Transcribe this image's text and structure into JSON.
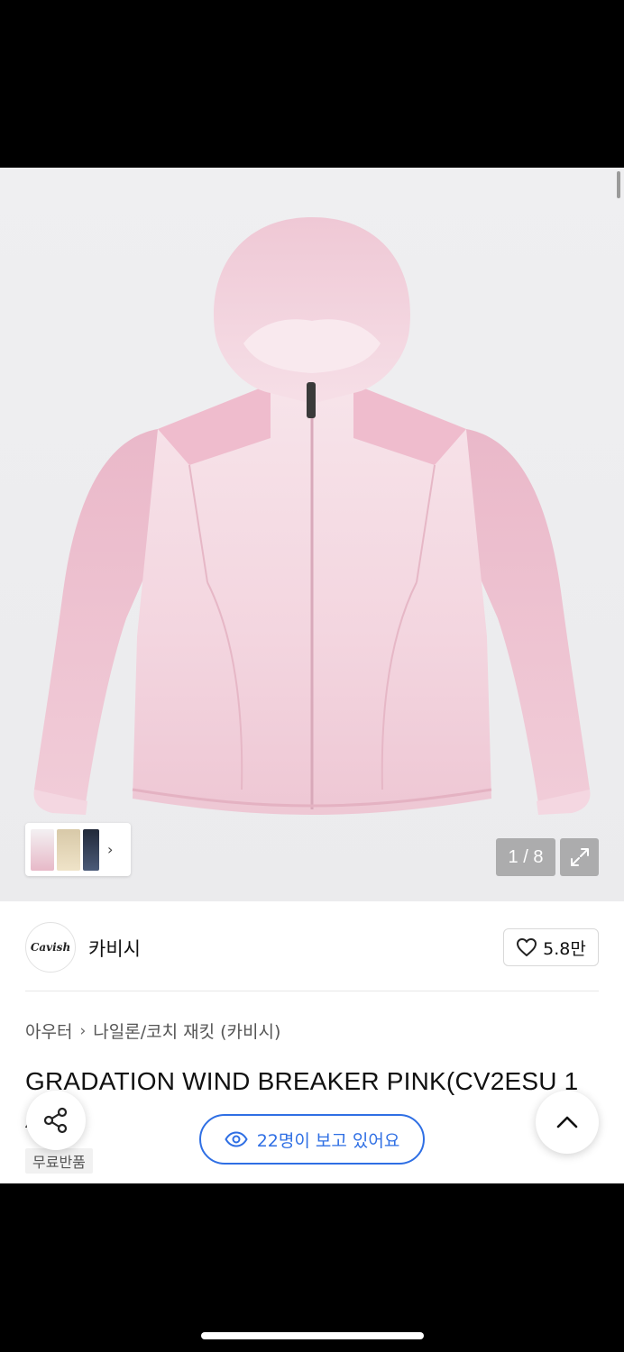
{
  "product": {
    "image_counter": "1 / 8",
    "brand_logo_text": "Cavish",
    "brand_name": "카비시",
    "like_count": "5.8만",
    "breadcrumb": [
      "아우터",
      "나일론/코치 재킷 (카비시)"
    ],
    "title": "GRADATION WIND BREAKER PINK(CV2ESU 1 A)",
    "badge": "무료반품",
    "viewers_text": "22명이 보고 있어요"
  },
  "icons": {
    "heart": "heart-icon",
    "share": "share-icon",
    "scroll_top": "chevron-up-icon",
    "eye": "eye-icon",
    "expand": "expand-icon",
    "thumb_next": "chevron-right-icon"
  },
  "colors": {
    "accent_blue": "#2f6fe4",
    "jacket_pink": "#efc6d3",
    "jacket_light": "#f8e6ec"
  }
}
